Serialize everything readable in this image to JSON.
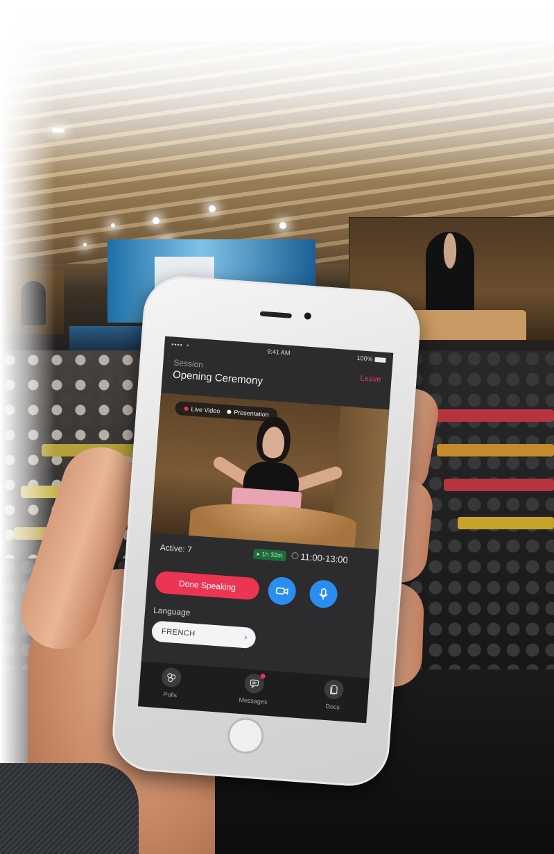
{
  "status_bar": {
    "signal": "•••• ◔",
    "time": "9:41 AM",
    "battery": "100%"
  },
  "header": {
    "label": "Session",
    "title": "Opening Ceremony",
    "leave": "Leave"
  },
  "video_tabs": [
    {
      "label": "Live Video",
      "dot_color": "#ec3553"
    },
    {
      "label": "Presentation",
      "dot_color": "#ffffff"
    }
  ],
  "info": {
    "active": "Active: 7",
    "duration": "▸ 1h 32m",
    "time_range": "11:00-13:00"
  },
  "controls": {
    "done_speaking": "Done Speaking",
    "camera_icon": "video-camera-icon",
    "mic_icon": "microphone-icon"
  },
  "language": {
    "label": "Language",
    "value": "FRENCH",
    "chevron": "›"
  },
  "nav": [
    {
      "label": "Polls",
      "icon": "polls-icon"
    },
    {
      "label": "Messages",
      "icon": "messages-icon",
      "has_badge": true
    },
    {
      "label": "Docs",
      "icon": "docs-icon"
    }
  ],
  "colors": {
    "accent_red": "#ec3553",
    "accent_blue": "#2b8df0",
    "screen_bg": "#2c2c2e",
    "nav_bg": "#1d1d1f"
  }
}
